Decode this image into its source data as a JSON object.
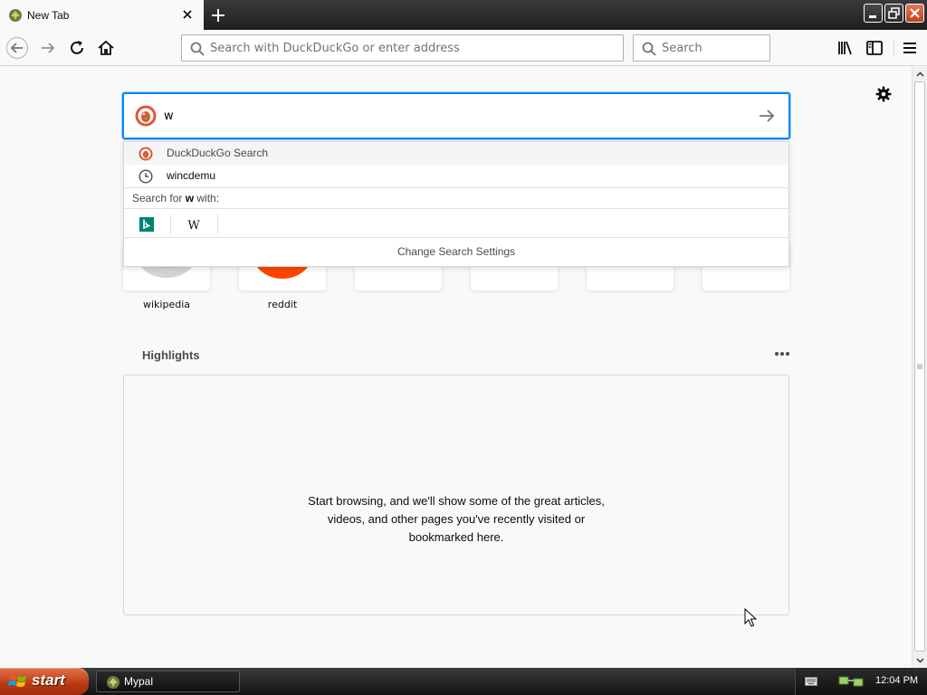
{
  "tab": {
    "title": "New Tab"
  },
  "navbar": {
    "url_placeholder": "Search with DuckDuckGo or enter address",
    "search_placeholder": "Search"
  },
  "topsites": [
    {
      "label": "wikipedia"
    },
    {
      "label": "reddit"
    },
    {
      "label": ""
    },
    {
      "label": ""
    },
    {
      "label": ""
    },
    {
      "label": ""
    }
  ],
  "search_dropdown": {
    "query": "w",
    "suggestions": [
      {
        "label": "DuckDuckGo Search",
        "icon": "duckduckgo-icon"
      },
      {
        "label": "wincdemu",
        "icon": "history-clock-icon"
      }
    ],
    "search_for_prefix": "Search for",
    "search_for_term": "w",
    "search_for_suffix": "with:",
    "engines": [
      {
        "name": "bing-icon"
      },
      {
        "name": "wikipedia-icon"
      }
    ],
    "change_settings": "Change Search Settings"
  },
  "highlights": {
    "title": "Highlights",
    "message_lines": [
      "Start browsing, and we'll show some of the great articles,",
      "videos, and other pages you've recently visited or",
      "bookmarked here."
    ]
  },
  "taskbar": {
    "start_label": "start",
    "task_label": "Mypal",
    "clock": "12:04 PM"
  },
  "colors": {
    "accent": "#0a84ff",
    "start_button": "#b83a12",
    "reddit": "#ff4500",
    "bing": "#008373"
  }
}
